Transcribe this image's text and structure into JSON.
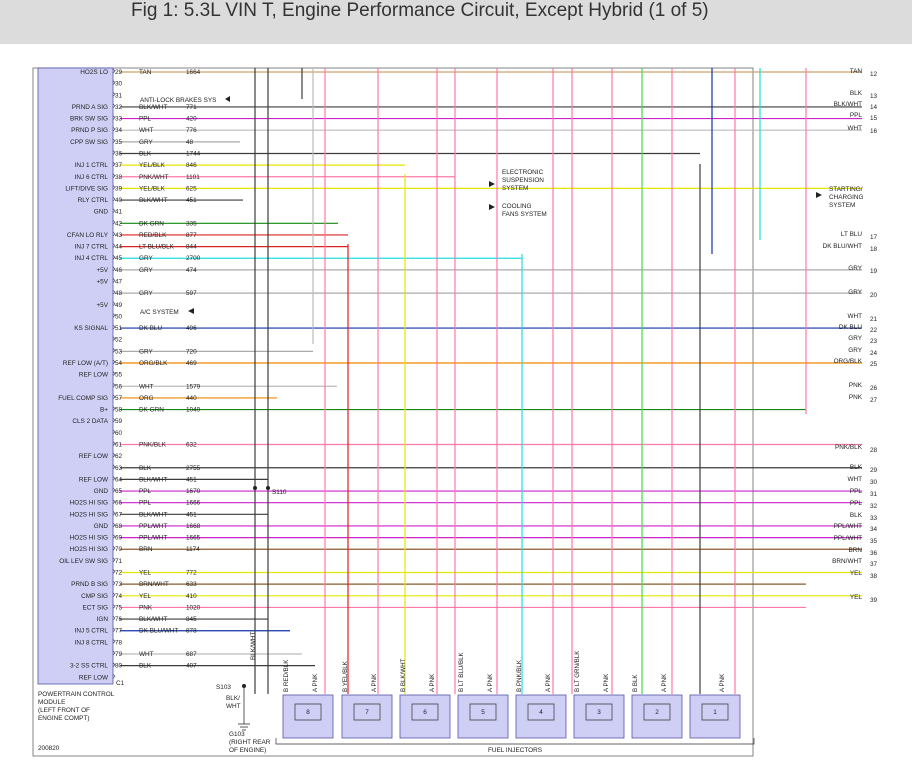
{
  "title": "Fig 1: 5.3L VIN T, Engine Performance Circuit, Except Hybrid (1 of 5)",
  "pcm": {
    "label_lines": [
      "POWERTRAIN CONTROL",
      "MODULE",
      "(LEFT FRONT OF",
      "ENGINE COMPT)"
    ],
    "connector": "C1",
    "ref": "200820"
  },
  "colors": {
    "TAN": "#c9a46a",
    "BLK": "#3c3c3c",
    "PPL": "#cc22cc",
    "WHT": "#bbbbbb",
    "GRY": "#aaaaaa",
    "YEL": "#e6e600",
    "DKGRN": "#118811",
    "RED": "#dd2222",
    "LTBLU": "#22dddd",
    "DKBLU": "#1133aa",
    "ORG": "#ee8800",
    "PNK": "#ff77aa",
    "BRN": "#8b5a2b",
    "LTGRN": "#44dd44",
    "BOX": "#cfcff5"
  },
  "pins": [
    {
      "n": "29",
      "label": "HO2S LO",
      "color": "TAN",
      "circuit": "1664"
    },
    {
      "n": "30",
      "label": "",
      "color": "",
      "circuit": ""
    },
    {
      "n": "31",
      "label": "",
      "color": "",
      "circuit": ""
    },
    {
      "n": "32",
      "label": "PRND A SIG",
      "color": "BLK/WHT",
      "circuit": "771"
    },
    {
      "n": "33",
      "label": "BRK SW SIG",
      "color": "PPL",
      "circuit": "420"
    },
    {
      "n": "34",
      "label": "PRND P SIG",
      "color": "WHT",
      "circuit": "776"
    },
    {
      "n": "35",
      "label": "CPP SW SIG",
      "color": "GRY",
      "circuit": "48"
    },
    {
      "n": "36",
      "label": "",
      "color": "BLK",
      "circuit": "1744"
    },
    {
      "n": "37",
      "label": "INJ 1 CTRL",
      "color": "YEL/BLK",
      "circuit": "846"
    },
    {
      "n": "38",
      "label": "INJ 6 CTRL",
      "color": "PNK/WHT",
      "circuit": "1101"
    },
    {
      "n": "39",
      "label": "LIFT/DIVE SIG",
      "color": "YEL/BLK",
      "circuit": "625"
    },
    {
      "n": "40",
      "label": "RLY CTRL",
      "color": "BLK/WHT",
      "circuit": "451"
    },
    {
      "n": "41",
      "label": "GND",
      "color": "",
      "circuit": ""
    },
    {
      "n": "42",
      "label": "",
      "color": "DK GRN",
      "circuit": "335"
    },
    {
      "n": "43",
      "label": "CFAN LO RLY",
      "color": "RED/BLK",
      "circuit": "877"
    },
    {
      "n": "44",
      "label": "INJ 7 CTRL",
      "color": "LT BLU/BLK",
      "circuit": "844"
    },
    {
      "n": "45",
      "label": "INJ 4 CTRL",
      "color": "GRY",
      "circuit": "2700"
    },
    {
      "n": "46",
      "label": "+5V",
      "color": "GRY",
      "circuit": "474"
    },
    {
      "n": "47",
      "label": "+5V",
      "color": "",
      "circuit": ""
    },
    {
      "n": "48",
      "label": "",
      "color": "GRY",
      "circuit": "597"
    },
    {
      "n": "49",
      "label": "+5V",
      "color": "",
      "circuit": ""
    },
    {
      "n": "50",
      "label": "",
      "color": "",
      "circuit": ""
    },
    {
      "n": "51",
      "label": "KS SIGNAL",
      "color": "DK BLU",
      "circuit": "496"
    },
    {
      "n": "52",
      "label": "",
      "color": "",
      "circuit": ""
    },
    {
      "n": "53",
      "label": "",
      "color": "GRY",
      "circuit": "720"
    },
    {
      "n": "54",
      "label": "REF LOW (A/T)",
      "color": "ORG/BLK",
      "circuit": "469"
    },
    {
      "n": "55",
      "label": "REF LOW",
      "color": "",
      "circuit": ""
    },
    {
      "n": "56",
      "label": "",
      "color": "WHT",
      "circuit": "1579"
    },
    {
      "n": "57",
      "label": "FUEL COMP SIG",
      "color": "ORG",
      "circuit": "440"
    },
    {
      "n": "58",
      "label": "B+",
      "color": "DK GRN",
      "circuit": "1049"
    },
    {
      "n": "59",
      "label": "CLS 2 DATA",
      "color": "",
      "circuit": ""
    },
    {
      "n": "60",
      "label": "",
      "color": "",
      "circuit": ""
    },
    {
      "n": "61",
      "label": "",
      "color": "PNK/BLK",
      "circuit": "632"
    },
    {
      "n": "62",
      "label": "REF LOW",
      "color": "",
      "circuit": ""
    },
    {
      "n": "63",
      "label": "",
      "color": "BLK",
      "circuit": "2755"
    },
    {
      "n": "64",
      "label": "REF LOW",
      "color": "BLK/WHT",
      "circuit": "451"
    },
    {
      "n": "65",
      "label": "GND",
      "color": "PPL",
      "circuit": "1670"
    },
    {
      "n": "66",
      "label": "HO2S HI SIG",
      "color": "PPL",
      "circuit": "1666"
    },
    {
      "n": "67",
      "label": "HO2S HI SIG",
      "color": "BLK/WHT",
      "circuit": "451"
    },
    {
      "n": "68",
      "label": "GND",
      "color": "PPL/WHT",
      "circuit": "1668"
    },
    {
      "n": "69",
      "label": "HO2S HI SIG",
      "color": "PPL/WHT",
      "circuit": "1665"
    },
    {
      "n": "70",
      "label": "HO2S HI SIG",
      "color": "BRN",
      "circuit": "1174"
    },
    {
      "n": "71",
      "label": "OIL LEV SW SIG",
      "color": "",
      "circuit": ""
    },
    {
      "n": "72",
      "label": "",
      "color": "YEL",
      "circuit": "772"
    },
    {
      "n": "73",
      "label": "PRND B SIG",
      "color": "BRN/WHT",
      "circuit": "633"
    },
    {
      "n": "74",
      "label": "CMP SIG",
      "color": "YEL",
      "circuit": "410"
    },
    {
      "n": "75",
      "label": "ECT SIG",
      "color": "PNK",
      "circuit": "1020"
    },
    {
      "n": "76",
      "label": "IGN",
      "color": "BLK/WHT",
      "circuit": "845"
    },
    {
      "n": "77",
      "label": "INJ 5 CTRL",
      "color": "DK BLU/WHT",
      "circuit": "878"
    },
    {
      "n": "78",
      "label": "INJ 8 CTRL",
      "color": "",
      "circuit": ""
    },
    {
      "n": "79",
      "label": "",
      "color": "WHT",
      "circuit": "687"
    },
    {
      "n": "80",
      "label": "3-2 SS CTRL",
      "color": "BLK",
      "circuit": "407"
    },
    {
      "n": "",
      "label": "REF LOW",
      "color": "",
      "circuit": ""
    }
  ],
  "right_labels": [
    {
      "n": "12",
      "color": "TAN"
    },
    {
      "n": "13",
      "color": "BLK"
    },
    {
      "n": "14",
      "color": "BLK/WHT"
    },
    {
      "n": "15",
      "color": "PPL"
    },
    {
      "n": "16",
      "color": "WHT"
    },
    {
      "n": "17",
      "color": "LT BLU"
    },
    {
      "n": "18",
      "color": "DK BLU/WHT"
    },
    {
      "n": "19",
      "color": "GRY"
    },
    {
      "n": "20",
      "color": "GRY"
    },
    {
      "n": "21",
      "color": "WHT"
    },
    {
      "n": "22",
      "color": "DK BLU"
    },
    {
      "n": "23",
      "color": "GRY"
    },
    {
      "n": "24",
      "color": "GRY"
    },
    {
      "n": "25",
      "color": "ORG/BLK"
    },
    {
      "n": "26",
      "color": "PNK"
    },
    {
      "n": "27",
      "color": "PNK"
    },
    {
      "n": "28",
      "color": "PNK/BLK"
    },
    {
      "n": "29",
      "color": "BLK"
    },
    {
      "n": "30",
      "color": "WHT"
    },
    {
      "n": "31",
      "color": "PPL"
    },
    {
      "n": "32",
      "color": "PPL"
    },
    {
      "n": "33",
      "color": "BLK"
    },
    {
      "n": "34",
      "color": "PPL/WHT"
    },
    {
      "n": "35",
      "color": "PPL/WHT"
    },
    {
      "n": "36",
      "color": "BRN"
    },
    {
      "n": "37",
      "color": "BRN/WHT"
    },
    {
      "n": "38",
      "color": "YEL"
    },
    {
      "n": "39",
      "color": "YEL"
    }
  ],
  "systems": {
    "abs": "ANTI-LOCK BRAKES SYS",
    "ac": "A/C SYSTEM",
    "ess": [
      "ELECTRONIC",
      "SUSPENSION",
      "SYSTEM"
    ],
    "cooling": [
      "COOLING",
      "FANS SYSTEM"
    ],
    "starting": [
      "STARTING/",
      "CHARGING",
      "SYSTEM"
    ]
  },
  "splice_s110": "S110",
  "splice_s103": "S103",
  "ground_g103": [
    "G103",
    "(RIGHT REAR",
    "OF ENGINE)"
  ],
  "vertical_blkwht": "BLK/WHT",
  "blkwht_under": [
    "BLK/",
    "WHT"
  ],
  "injectors_label": "FUEL INJECTORS",
  "injectors": [
    {
      "num": "8",
      "pin_b": "B",
      "color_b": "RED/BLK",
      "pin_a": "A",
      "color_a": "PNK"
    },
    {
      "num": "7",
      "pin_b": "B",
      "color_b": "YEL/BLK",
      "pin_a": "A",
      "color_a": "PNK"
    },
    {
      "num": "6",
      "pin_b": "B",
      "color_b": "BLK/WHT",
      "pin_a": "A",
      "color_a": "PNK"
    },
    {
      "num": "5",
      "pin_b": "B",
      "color_b": "LT BLU/BLK",
      "pin_a": "A",
      "color_a": "PNK"
    },
    {
      "num": "4",
      "pin_b": "B",
      "color_b": "PNK/BLK",
      "pin_a": "A",
      "color_a": "PNK"
    },
    {
      "num": "3",
      "pin_b": "B",
      "color_b": "LT GRN/BLK",
      "pin_a": "A",
      "color_a": "PNK"
    },
    {
      "num": "2",
      "pin_b": "B",
      "color_b": "BLK",
      "pin_a": "A",
      "color_a": "PNK"
    },
    {
      "num": "1",
      "pin_b": "",
      "color_b": "",
      "pin_a": "A",
      "color_a": "PNK"
    }
  ]
}
